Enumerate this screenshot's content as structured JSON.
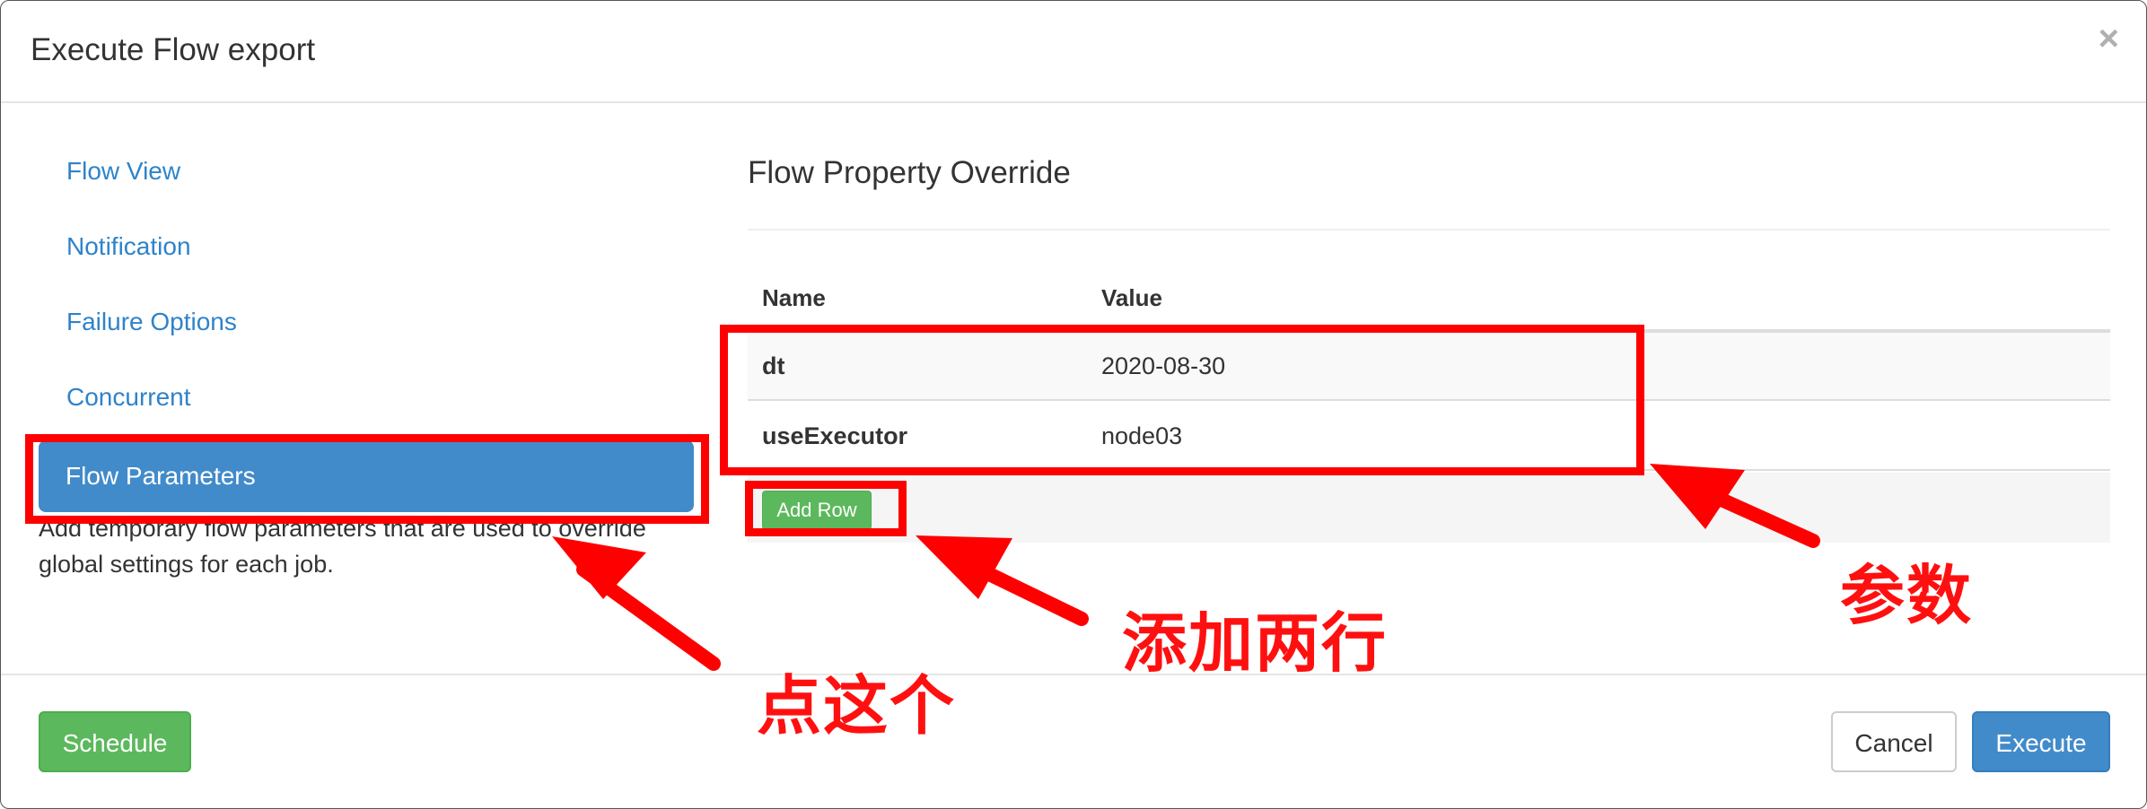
{
  "modal": {
    "title": "Execute Flow export",
    "close_glyph": "×"
  },
  "sidebar": {
    "items": [
      {
        "label": "Flow View"
      },
      {
        "label": "Notification"
      },
      {
        "label": "Failure Options"
      },
      {
        "label": "Concurrent"
      },
      {
        "label": "Flow Parameters",
        "active": true
      }
    ],
    "help_text": "Add temporary flow parameters that are used to override global settings for each job."
  },
  "main": {
    "section_title": "Flow Property Override",
    "table": {
      "headers": [
        "Name",
        "Value"
      ],
      "rows": [
        {
          "name": "dt",
          "value": "2020-08-30"
        },
        {
          "name": "useExecutor",
          "value": "node03"
        }
      ],
      "add_row_label": "Add Row"
    }
  },
  "footer": {
    "schedule_label": "Schedule",
    "cancel_label": "Cancel",
    "execute_label": "Execute"
  },
  "annotations": {
    "click_this": "点这个",
    "add_two_rows": "添加两行",
    "parameters": "参数"
  },
  "colors": {
    "link": "#2f83c9",
    "primary": "#428bca",
    "success": "#5cb85c",
    "annotation": "#ff0000"
  }
}
